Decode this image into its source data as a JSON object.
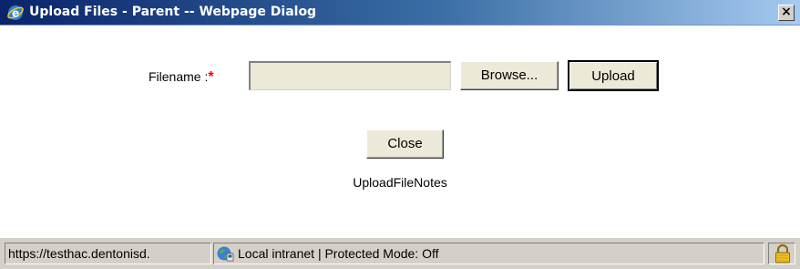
{
  "window": {
    "title": "Upload Files - Parent -- Webpage Dialog",
    "close_glyph": "×",
    "icon": "ie-icon"
  },
  "form": {
    "filename_label": "Filename :",
    "required_marker": "*",
    "file_value": "",
    "browse_label": "Browse...",
    "upload_label": "Upload",
    "close_label": "Close",
    "notes": "UploadFileNotes"
  },
  "statusbar": {
    "url": "https://testhac.dentonisd.",
    "zone": "Local intranet | Protected Mode: Off",
    "zone_icon": "globe-icon",
    "lock_icon": "lock-icon"
  },
  "colors": {
    "titlebar_start": "#0a246a",
    "titlebar_end": "#a6caf0",
    "required": "#ff0000",
    "chrome": "#d4d0c8"
  }
}
